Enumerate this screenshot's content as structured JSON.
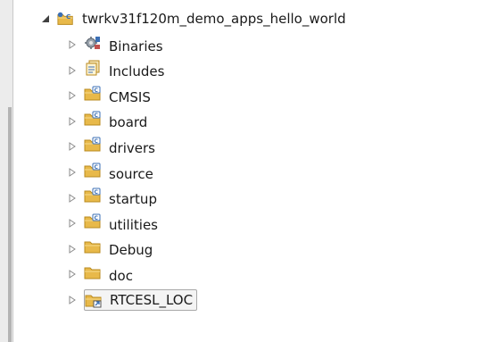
{
  "project": {
    "name": "twrkv31f120m_demo_apps_hello_world",
    "expanded": true
  },
  "children": [
    {
      "label": "Binaries",
      "icon": "binaries-icon"
    },
    {
      "label": "Includes",
      "icon": "includes-icon"
    },
    {
      "label": "CMSIS",
      "icon": "source-folder-icon"
    },
    {
      "label": "board",
      "icon": "source-folder-icon"
    },
    {
      "label": "drivers",
      "icon": "source-folder-icon"
    },
    {
      "label": "source",
      "icon": "source-folder-icon"
    },
    {
      "label": "startup",
      "icon": "source-folder-icon"
    },
    {
      "label": "utilities",
      "icon": "source-folder-icon"
    },
    {
      "label": "Debug",
      "icon": "folder-icon"
    },
    {
      "label": "doc",
      "icon": "folder-icon"
    },
    {
      "label": "RTCESL_LOC",
      "icon": "linked-folder-icon",
      "selected": true
    }
  ],
  "colors": {
    "folder": "#e8b94a",
    "folder_dark": "#b98a1f",
    "source_overlay": "#3b6fb5"
  }
}
